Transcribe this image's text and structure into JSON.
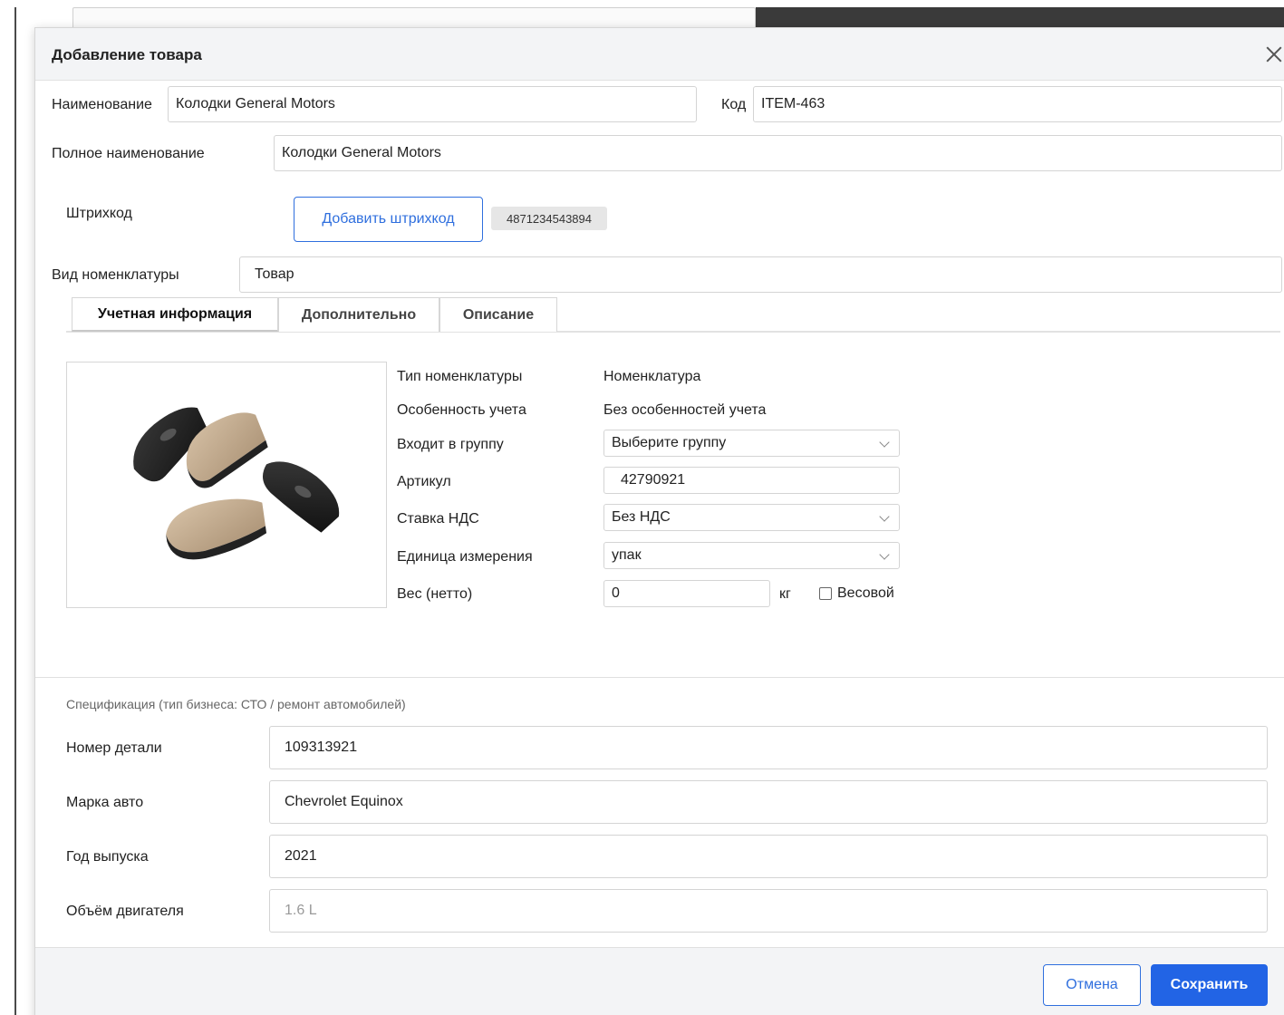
{
  "dialog": {
    "title": "Добавление товара"
  },
  "fields": {
    "name_label": "Наименование",
    "name_value": "Колодки General Motors",
    "code_label": "Код",
    "code_value": "ITEM-463",
    "full_name_label": "Полное наименование",
    "full_name_value": "Колодки General Motors",
    "barcode_label": "Штрихкод",
    "add_barcode_button": "Добавить штрихкод",
    "barcode_value": "4871234543894",
    "nomenclature_kind_label": "Вид номенклатуры",
    "nomenclature_kind_value": "Товар"
  },
  "tabs": [
    {
      "label": "Учетная информация",
      "active": true
    },
    {
      "label": "Дополнительно",
      "active": false
    },
    {
      "label": "Описание",
      "active": false
    }
  ],
  "accounting": {
    "type_label": "Тип номенклатуры",
    "type_value": "Номенклатура",
    "feature_label": "Особенность учета",
    "feature_value": "Без особенностей учета",
    "group_label": "Входит в группу",
    "group_value": "Выберите группу",
    "article_label": "Артикул",
    "article_value": "42790921",
    "vat_label": "Ставка НДС",
    "vat_value": "Без НДС",
    "unit_label": "Единица измерения",
    "unit_value": "упак",
    "weight_label": "Вес (нетто)",
    "weight_value": "0",
    "weight_unit": "кг",
    "weighted_label": "Весовой",
    "weighted_checked": false
  },
  "spec": {
    "title": "Спецификация (тип бизнеса: СТО / ремонт автомобилей)",
    "part_number_label": "Номер детали",
    "part_number_value": "109313921",
    "car_brand_label": "Марка авто",
    "car_brand_value": "Chevrolet Equinox",
    "year_label": "Год выпуска",
    "year_value": "2021",
    "engine_label": "Объём двигателя",
    "engine_placeholder": "1.6 L"
  },
  "footer": {
    "cancel_label": "Отмена",
    "save_label": "Сохранить"
  },
  "colors": {
    "accent": "#2264e5",
    "outline_button": "#2f6fde"
  }
}
